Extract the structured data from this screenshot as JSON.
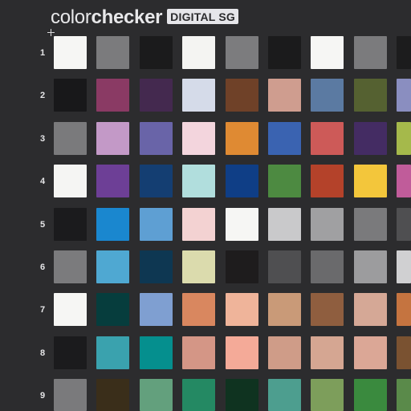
{
  "brand": {
    "word_light": "color",
    "word_bold": "checker",
    "badge": "DIGITAL SG"
  },
  "rows": [
    {
      "label": "1",
      "colors": [
        "#f6f6f4",
        "#7b7b7d",
        "#1b1b1c",
        "#f4f4f2",
        "#7c7c7e",
        "#1b1b1c",
        "#f6f6f4",
        "#7b7b7d",
        "#1c1c1d"
      ]
    },
    {
      "label": "2",
      "colors": [
        "#18181a",
        "#8a3a64",
        "#44294f",
        "#d5dbe9",
        "#6f4128",
        "#cf9d8f",
        "#5b7aa2",
        "#556131",
        "#8a8ec0"
      ]
    },
    {
      "label": "3",
      "colors": [
        "#7a7a7c",
        "#c399c7",
        "#6964a8",
        "#f3d5dd",
        "#df8a33",
        "#3a63b1",
        "#cd5a58",
        "#442c63",
        "#a5b94b"
      ]
    },
    {
      "label": "4",
      "colors": [
        "#f5f5f3",
        "#6d3f96",
        "#143e72",
        "#b1dedd",
        "#0f3e86",
        "#4d8a41",
        "#b4422a",
        "#f3c63b",
        "#c05c9a"
      ]
    },
    {
      "label": "5",
      "colors": [
        "#1b1b1d",
        "#1a87cf",
        "#5e9fd3",
        "#f3d2d2",
        "#f6f6f4",
        "#c9c9cb",
        "#a0a0a2",
        "#7a7a7c",
        "#4f4f51"
      ]
    },
    {
      "label": "6",
      "colors": [
        "#7b7b7d",
        "#4fa8d2",
        "#0e3752",
        "#dbdbad",
        "#1e1c1d",
        "#4f4f51",
        "#6a6a6c",
        "#9c9c9e",
        "#d0d0d2"
      ]
    },
    {
      "label": "7",
      "colors": [
        "#f6f6f4",
        "#063d3d",
        "#7f9fd1",
        "#d9875f",
        "#efb49a",
        "#c99a78",
        "#8f5e3f",
        "#d5a896",
        "#c57440"
      ]
    },
    {
      "label": "8",
      "colors": [
        "#1b1b1d",
        "#3aa2ae",
        "#058f8e",
        "#d49686",
        "#f4aa98",
        "#cf9c88",
        "#d5a692",
        "#dba796",
        "#7a5231"
      ]
    },
    {
      "label": "9",
      "colors": [
        "#7a7a7c",
        "#3a2e1a",
        "#63a07d",
        "#248963",
        "#0f3320",
        "#4d9e8f",
        "#7d9e5b",
        "#3a8a3e",
        "#5a8a4a"
      ]
    }
  ]
}
